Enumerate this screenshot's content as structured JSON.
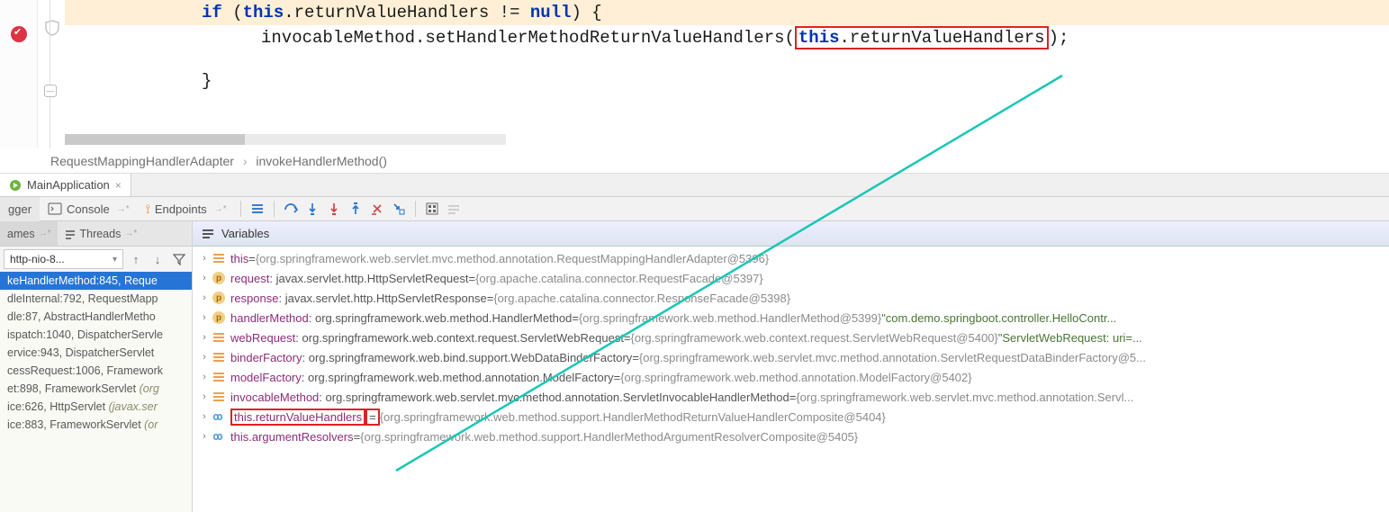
{
  "editor": {
    "line1": {
      "kw1": "if",
      "open": " (",
      "kw2": "this",
      "mid": ".returnValueHandlers != ",
      "kw3": "null",
      "end": ") {"
    },
    "line2": {
      "pre": "invocableMethod.setHandlerMethodReturnValueHandlers(",
      "box_kw": "this",
      "box_rest": ".returnValueHandlers",
      "post": ");"
    },
    "line3": "}"
  },
  "breadcrumb": {
    "class": "RequestMappingHandlerAdapter",
    "method": "invokeHandlerMethod()"
  },
  "tab": {
    "title": "MainApplication"
  },
  "toolbar": {
    "debugger": "gger",
    "console": "Console",
    "endpoints": "Endpoints"
  },
  "frames": {
    "tab1": "ames",
    "tab2": "Threads",
    "thread": "http-nio-8...",
    "items": [
      {
        "text": "keHandlerMethod:845, Reque",
        "sel": true
      },
      {
        "text": "dleInternal:792, RequestMapp"
      },
      {
        "text": "dle:87, AbstractHandlerMetho"
      },
      {
        "text": "ispatch:1040, DispatcherServle"
      },
      {
        "text": "ervice:943, DispatcherServlet "
      },
      {
        "text": "cessRequest:1006, Framework"
      },
      {
        "text": "et:898, FrameworkServlet ",
        "lib": "(org"
      },
      {
        "text": "ice:626, HttpServlet ",
        "lib": "(javax.ser"
      },
      {
        "text": "ice:883, FrameworkServlet ",
        "lib": "(or"
      }
    ]
  },
  "variables": {
    "header": "Variables",
    "rows": [
      {
        "icon": "f",
        "name": "this",
        "eq": " = ",
        "val": "{org.springframework.web.servlet.mvc.method.annotation.RequestMappingHandlerAdapter@5396}"
      },
      {
        "icon": "p",
        "name": "request",
        "type": ": javax.servlet.http.HttpServletRequest ",
        "eq": " = ",
        "val": "{org.apache.catalina.connector.RequestFacade@5397}"
      },
      {
        "icon": "p",
        "name": "response",
        "type": ": javax.servlet.http.HttpServletResponse ",
        "eq": " = ",
        "val": "{org.apache.catalina.connector.ResponseFacade@5398}"
      },
      {
        "icon": "p",
        "name": "handlerMethod",
        "type": ": org.springframework.web.method.HandlerMethod ",
        "eq": " = ",
        "val": "{org.springframework.web.method.HandlerMethod@5399}",
        "str": " \"com.demo.springboot.controller.HelloContr..."
      },
      {
        "icon": "f",
        "name": "webRequest",
        "type": ": org.springframework.web.context.request.ServletWebRequest ",
        "eq": " = ",
        "val": "{org.springframework.web.context.request.ServletWebRequest@5400}",
        "str": " \"ServletWebRequest: uri=..."
      },
      {
        "icon": "f",
        "name": "binderFactory",
        "type": ": org.springframework.web.bind.support.WebDataBinderFactory ",
        "eq": " = ",
        "val": "{org.springframework.web.servlet.mvc.method.annotation.ServletRequestDataBinderFactory@5..."
      },
      {
        "icon": "f",
        "name": "modelFactory",
        "type": ": org.springframework.web.method.annotation.ModelFactory ",
        "eq": " = ",
        "val": "{org.springframework.web.method.annotation.ModelFactory@5402}"
      },
      {
        "icon": "f",
        "name": "invocableMethod",
        "type": ": org.springframework.web.servlet.mvc.method.annotation.ServletInvocableHandlerMethod ",
        "eq": " = ",
        "val": "{org.springframework.web.servlet.mvc.method.annotation.Servl..."
      },
      {
        "icon": "oo",
        "name": "this.returnValueHandlers",
        "eq": " = ",
        "val": "{org.springframework.web.method.support.HandlerMethodReturnValueHandlerComposite@5404}",
        "boxed": true
      },
      {
        "icon": "oo",
        "name": "this.argumentResolvers",
        "eq": " = ",
        "val": "{org.springframework.web.method.support.HandlerMethodArgumentResolverComposite@5405}"
      }
    ]
  }
}
